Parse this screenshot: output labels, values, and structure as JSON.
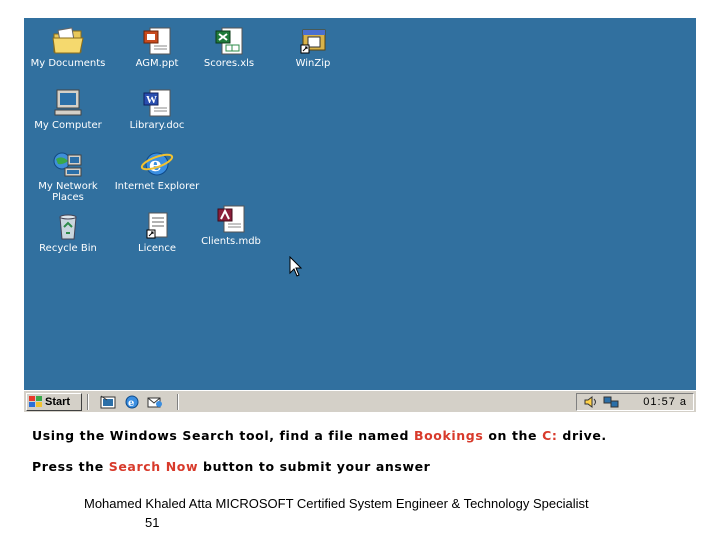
{
  "desktop": {
    "icons": [
      {
        "label": "My Documents",
        "icon": "folder-documents-icon"
      },
      {
        "label": "AGM.ppt",
        "icon": "powerpoint-file-icon"
      },
      {
        "label": "Scores.xls",
        "icon": "excel-file-icon"
      },
      {
        "label": "WinZip",
        "icon": "winzip-shortcut-icon"
      },
      {
        "label": "My Computer",
        "icon": "computer-icon"
      },
      {
        "label": "Library.doc",
        "icon": "word-file-icon"
      },
      {
        "label": "My Network Places",
        "icon": "network-icon"
      },
      {
        "label": "Internet Explorer",
        "icon": "internet-explorer-icon"
      },
      {
        "label": "Recycle Bin",
        "icon": "recycle-bin-icon"
      },
      {
        "label": "Licence",
        "icon": "text-file-shortcut-icon"
      },
      {
        "label": "Clients.mdb",
        "icon": "access-file-icon"
      }
    ],
    "background_color": "#31709f"
  },
  "taskbar": {
    "start_label": "Start",
    "clock": "01:57 a"
  },
  "instructions": {
    "line1_a": "Using the Windows Search tool, find a file named ",
    "line1_file": "Bookings",
    "line1_b": " on the ",
    "line1_drive": "C:",
    "line1_c": " drive.",
    "line2_a": "Press the ",
    "line2_button": "Search Now",
    "line2_b": " button to submit your answer",
    "highlight_color": "#d83a2b"
  },
  "footer": {
    "credit": "Mohamed Khaled Atta MICROSOFT Certified System Engineer & Technology Specialist",
    "page_number": "51"
  }
}
